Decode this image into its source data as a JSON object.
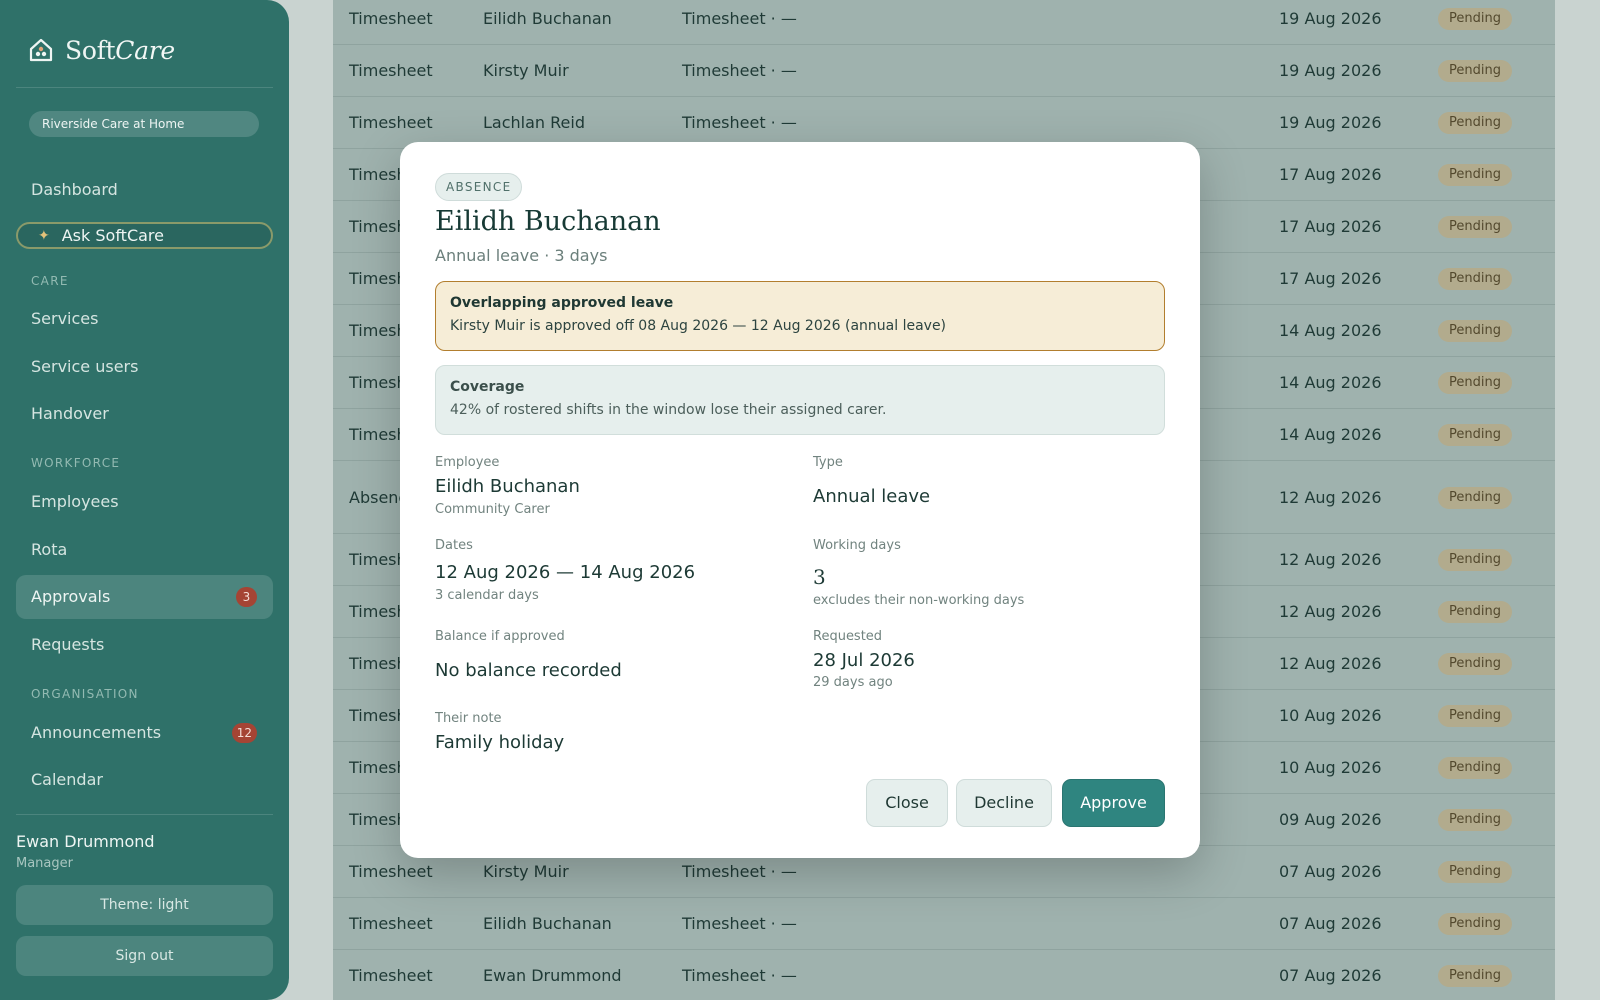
{
  "app": {
    "brand_soft": "Soft",
    "brand_care": "Care",
    "org": "Riverside Care at Home"
  },
  "sidebar": {
    "dashboard": "Dashboard",
    "ask": "Ask SoftCare",
    "care_label": "CARE",
    "services": "Services",
    "service_users": "Service users",
    "handover": "Handover",
    "workforce_label": "WORKFORCE",
    "employees": "Employees",
    "rota": "Rota",
    "approvals": "Approvals",
    "approvals_badge": "3",
    "requests": "Requests",
    "organisation_label": "ORGANISATION",
    "announcements": "Announcements",
    "announcements_badge": "12",
    "calendar": "Calendar",
    "user_name": "Ewan Drummond",
    "user_role": "Manager",
    "theme_button": "Theme: light",
    "signout_button": "Sign out"
  },
  "table": {
    "rows": [
      {
        "kind": "Timesheet",
        "name": "Eilidh Buchanan",
        "detail": "Timesheet · —",
        "date": "19 Aug 2026",
        "status": "Pending"
      },
      {
        "kind": "Timesheet",
        "name": "Kirsty Muir",
        "detail": "Timesheet · —",
        "date": "19 Aug 2026",
        "status": "Pending"
      },
      {
        "kind": "Timesheet",
        "name": "Lachlan Reid",
        "detail": "Timesheet · —",
        "date": "19 Aug 2026",
        "status": "Pending"
      },
      {
        "kind": "Timesh",
        "name": "",
        "detail": "",
        "date": "17 Aug 2026",
        "status": "Pending"
      },
      {
        "kind": "Timesh",
        "name": "",
        "detail": "",
        "date": "17 Aug 2026",
        "status": "Pending"
      },
      {
        "kind": "Timesh",
        "name": "",
        "detail": "",
        "date": "17 Aug 2026",
        "status": "Pending"
      },
      {
        "kind": "Timesh",
        "name": "",
        "detail": "",
        "date": "14 Aug 2026",
        "status": "Pending"
      },
      {
        "kind": "Timesh",
        "name": "",
        "detail": "",
        "date": "14 Aug 2026",
        "status": "Pending"
      },
      {
        "kind": "Timesh",
        "name": "",
        "detail": "",
        "date": "14 Aug 2026",
        "status": "Pending"
      },
      {
        "kind": "Absenc",
        "name": "",
        "detail": "",
        "date": "12 Aug 2026",
        "status": "Pending"
      },
      {
        "kind": "Timesh",
        "name": "",
        "detail": "",
        "date": "12 Aug 2026",
        "status": "Pending"
      },
      {
        "kind": "Timesh",
        "name": "",
        "detail": "",
        "date": "12 Aug 2026",
        "status": "Pending"
      },
      {
        "kind": "Timesh",
        "name": "",
        "detail": "",
        "date": "12 Aug 2026",
        "status": "Pending"
      },
      {
        "kind": "Timesh",
        "name": "",
        "detail": "",
        "date": "10 Aug 2026",
        "status": "Pending"
      },
      {
        "kind": "Timesh",
        "name": "",
        "detail": "",
        "date": "10 Aug 2026",
        "status": "Pending"
      },
      {
        "kind": "Timesh",
        "name": "",
        "detail": "",
        "date": "09 Aug 2026",
        "status": "Pending"
      },
      {
        "kind": "Timesheet",
        "name": "Kirsty Muir",
        "detail": "Timesheet · —",
        "date": "07 Aug 2026",
        "status": "Pending"
      },
      {
        "kind": "Timesheet",
        "name": "Eilidh Buchanan",
        "detail": "Timesheet · —",
        "date": "07 Aug 2026",
        "status": "Pending"
      },
      {
        "kind": "Timesheet",
        "name": "Ewan Drummond",
        "detail": "Timesheet · —",
        "date": "07 Aug 2026",
        "status": "Pending"
      }
    ]
  },
  "modal": {
    "tag": "ABSENCE",
    "title": "Eilidh Buchanan",
    "subtitle": "Annual leave · 3 days",
    "warning_title": "Overlapping approved leave",
    "warning_body": "Kirsty Muir is approved off 08 Aug 2026 — 12 Aug 2026 (annual leave)",
    "coverage_title": "Coverage",
    "coverage_body": "42% of rostered shifts in the window lose their assigned carer.",
    "employee_label": "Employee",
    "employee_value": "Eilidh Buchanan",
    "employee_hint": "Community Carer",
    "type_label": "Type",
    "type_value": "Annual leave",
    "dates_label": "Dates",
    "dates_value": "12 Aug 2026 — 14 Aug 2026",
    "dates_hint": "3 calendar days",
    "working_label": "Working days",
    "working_value": "3",
    "working_hint": "excludes their non-working days",
    "balance_label": "Balance if approved",
    "balance_value": "No balance recorded",
    "requested_label": "Requested",
    "requested_value": "28 Jul 2026",
    "requested_hint": "29 days ago",
    "note_label": "Their note",
    "note_value": "Family holiday",
    "close_button": "Close",
    "decline_button": "Decline",
    "approve_button": "Approve"
  },
  "colors": {
    "sidebar": "#2f7169",
    "primary": "#2f8580",
    "warning_border": "#b27e2e",
    "badge": "#a54434"
  }
}
